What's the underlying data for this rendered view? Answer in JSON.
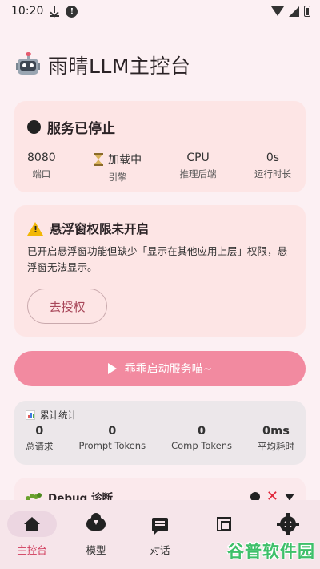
{
  "status_bar": {
    "time": "10:20"
  },
  "app": {
    "title": "雨晴LLM主控台"
  },
  "service": {
    "status_text": "服务已停止",
    "stats": [
      {
        "value": "8080",
        "label": "端口"
      },
      {
        "value": "加载中",
        "label": "引擎"
      },
      {
        "value": "CPU",
        "label": "推理后端"
      },
      {
        "value": "0s",
        "label": "运行时长"
      }
    ]
  },
  "overlay_warning": {
    "title": "悬浮窗权限未开启",
    "message": "已开启悬浮窗功能但缺少「显示在其他应用上层」权限，悬浮窗无法显示。",
    "button_label": "去授权"
  },
  "start_button": {
    "label": "乖乖启动服务喵~"
  },
  "stats": {
    "title": "累计统计",
    "items": [
      {
        "value": "0",
        "label": "总请求"
      },
      {
        "value": "0",
        "label": "Prompt Tokens"
      },
      {
        "value": "0",
        "label": "Comp Tokens"
      },
      {
        "value": "0ms",
        "label": "平均耗时"
      }
    ]
  },
  "debug": {
    "title": "Debug 诊断"
  },
  "nav": {
    "items": [
      {
        "label": "主控台",
        "icon": "home-icon",
        "active": true
      },
      {
        "label": "模型",
        "icon": "cloud-download-icon"
      },
      {
        "label": "对话",
        "icon": "chat-icon"
      },
      {
        "label": "",
        "icon": "chip-icon"
      },
      {
        "label": "",
        "icon": "gear-icon"
      }
    ]
  },
  "watermark": {
    "text": "谷普软件园"
  },
  "colors": {
    "accent": "#f28aa0",
    "active": "#d0395a",
    "card": "#fde5e5"
  }
}
